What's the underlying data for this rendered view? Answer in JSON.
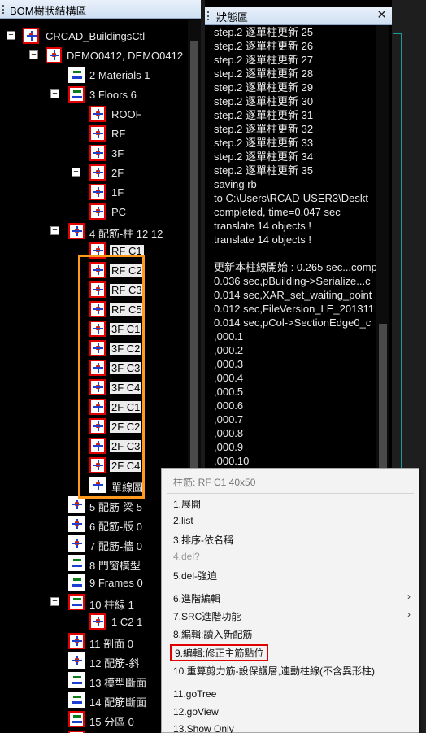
{
  "left_panel": {
    "title": "BOM樹狀結構區",
    "nodes": [
      {
        "label": "CRCAD_BuildingsCtl"
      },
      {
        "label": "DEMO0412, DEMO0412"
      },
      {
        "label": "2 Materials 1"
      },
      {
        "label": "3 Floors 6"
      },
      {
        "label": "ROOF"
      },
      {
        "label": "RF"
      },
      {
        "label": "3F"
      },
      {
        "label": "2F"
      },
      {
        "label": "1F"
      },
      {
        "label": "PC"
      },
      {
        "label": "4 配筋-柱 12 12"
      },
      {
        "label": "RF C1"
      },
      {
        "label": "RF C2"
      },
      {
        "label": "RF C3"
      },
      {
        "label": "RF C5"
      },
      {
        "label": "3F C1"
      },
      {
        "label": "3F C2"
      },
      {
        "label": "3F C3"
      },
      {
        "label": "3F C4"
      },
      {
        "label": "2F C1"
      },
      {
        "label": "2F C2"
      },
      {
        "label": "2F C3"
      },
      {
        "label": "2F C4"
      },
      {
        "label": "單線圖"
      },
      {
        "label": "5 配筋-梁 5"
      },
      {
        "label": "6 配筋-版 0"
      },
      {
        "label": "7 配筋-牆 0"
      },
      {
        "label": "8 門窗模型"
      },
      {
        "label": "9 Frames 0"
      },
      {
        "label": "10 柱線 1"
      },
      {
        "label": "1 C2 1"
      },
      {
        "label": "11 剖面 0"
      },
      {
        "label": "12 配筋-斜"
      },
      {
        "label": "13 模型斷面"
      },
      {
        "label": "14 配筋斷面"
      },
      {
        "label": "15 分區 0"
      }
    ]
  },
  "right_panel": {
    "title": "狀態區",
    "close_glyph": "✕",
    "lines": [
      "step.2 逐單柱更新 25",
      "step.2 逐單柱更新 26",
      "step.2 逐單柱更新 27",
      "step.2 逐單柱更新 28",
      "step.2 逐單柱更新 29",
      "step.2 逐單柱更新 30",
      "step.2 逐單柱更新 31",
      "step.2 逐單柱更新 32",
      "step.2 逐單柱更新 33",
      "step.2 逐單柱更新 34",
      "step.2 逐單柱更新 35",
      "saving rb",
      " to C:\\Users\\RCAD-USER3\\Deskt",
      "completed, time=0.047 sec",
      "translate 14 objects !",
      "translate 14 objects !",
      "",
      "更新本柱線開始 : 0.265 sec...comp",
      "0.036 sec,pBuilding->Serialize...c",
      "0.014 sec,XAR_set_waiting_point",
      "0.012 sec,FileVersion_LE_201311",
      "0.014 sec,pCol->SectionEdge0_c",
      ",000.1",
      ",000.2",
      ",000.3",
      ",000.4",
      ",000.5",
      ",000.6",
      ",000.7",
      ",000.8",
      ",000.9",
      ",000.10"
    ]
  },
  "context_menu": {
    "title": "柱筋: RF C1 40x50",
    "items": [
      {
        "label": "1.展開",
        "submenu": false
      },
      {
        "label": "2.list",
        "submenu": false
      },
      {
        "label": "3.排序-依名稱",
        "submenu": false
      },
      {
        "label": "4.del?",
        "submenu": false
      },
      {
        "label": "5.del-強迫",
        "submenu": false
      },
      {
        "label": "6.進階編輯",
        "submenu": true
      },
      {
        "label": "7.SRC進階功能",
        "submenu": true
      },
      {
        "label": "8.編輯:讀入新配筋",
        "submenu": false
      },
      {
        "label": "9.編輯:修正主筋點位",
        "submenu": false
      },
      {
        "label": "10.重算剪力筋-設保護層,連動柱線(不含異形柱)",
        "submenu": false
      },
      {
        "label": "11.goTree",
        "submenu": false
      },
      {
        "label": "12.goView",
        "submenu": false
      },
      {
        "label": "13.Show Only",
        "submenu": false
      }
    ],
    "submenu_glyph": "›"
  }
}
